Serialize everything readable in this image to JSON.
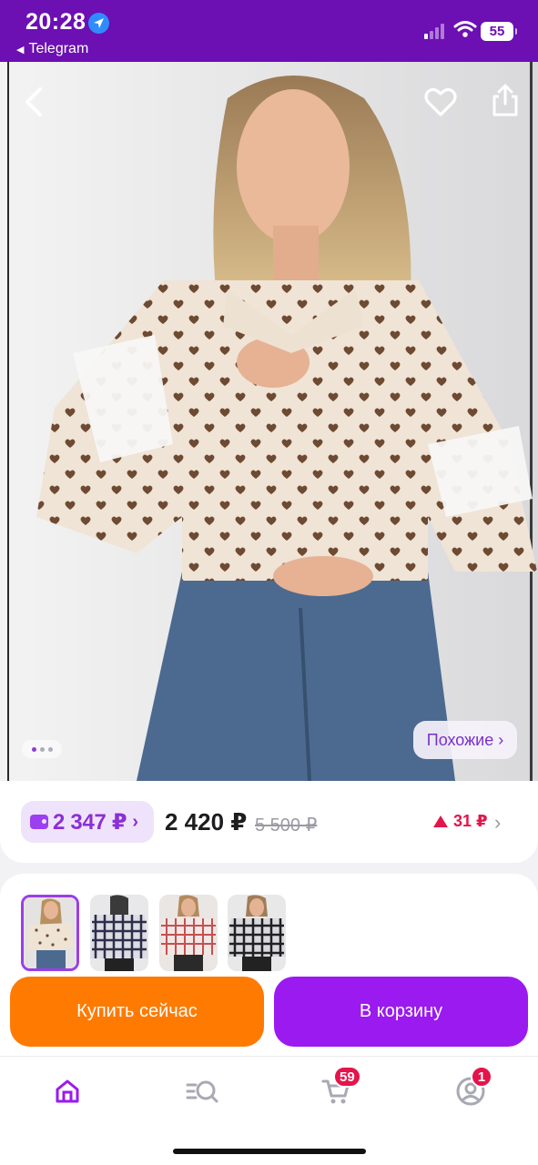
{
  "status_bar": {
    "time": "20:28",
    "back_app": "Telegram",
    "battery": "55"
  },
  "hero": {
    "similar_label": "Похожие ›",
    "photo_count": 3,
    "active_photo": 1
  },
  "price": {
    "wallet_amount": "2 347 ₽",
    "wallet_chevron": "›",
    "current": "2 420 ₽",
    "old": "5 500 ₽",
    "change": "31 ₽",
    "change_direction": "up",
    "row_chevron": "›"
  },
  "variants": [
    {
      "name": "beige-hearts",
      "selected": true
    },
    {
      "name": "navy-plaid",
      "selected": false
    },
    {
      "name": "red-plaid",
      "selected": false
    },
    {
      "name": "black-plaid",
      "selected": false
    }
  ],
  "actions": {
    "buy_now": "Купить сейчас",
    "add_to_cart": "В корзину"
  },
  "tabbar": {
    "items": [
      {
        "icon": "home-icon",
        "active": true
      },
      {
        "icon": "catalog-search-icon",
        "active": false
      },
      {
        "icon": "cart-icon",
        "badge": "59"
      },
      {
        "icon": "profile-icon",
        "badge": "1"
      }
    ]
  },
  "colors": {
    "status_bar": "#6c0fb3",
    "accent_purple": "#9a1af0",
    "buy_orange": "#ff7a00",
    "price_up_red": "#e3154b"
  }
}
